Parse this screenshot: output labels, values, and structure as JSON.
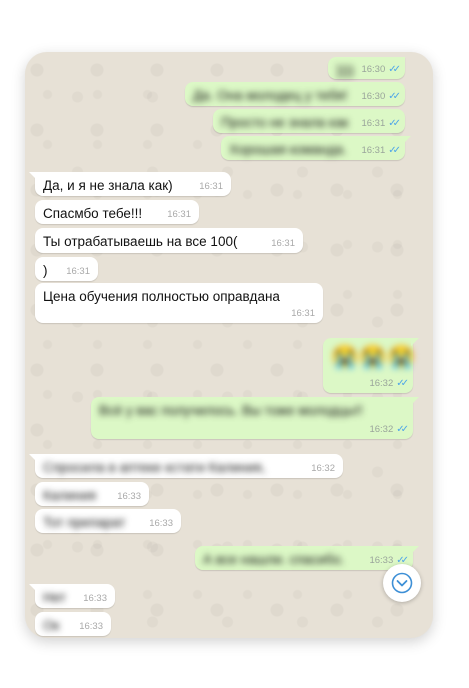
{
  "messages": [
    {
      "side": "out",
      "text": "))))",
      "time": "16:30",
      "blurred": true
    },
    {
      "side": "out",
      "text": "Да. Она молодец у тебя!",
      "time": "16:30",
      "blurred": true
    },
    {
      "side": "out",
      "text": "Просто не знала как",
      "time": "16:31",
      "blurred": true
    },
    {
      "side": "out",
      "text": "Хорошая команда.",
      "time": "16:31",
      "blurred": true
    },
    {
      "side": "in",
      "text": "Да, и я не знала как)",
      "time": "16:31",
      "blurred": false
    },
    {
      "side": "in",
      "text": "Спасмбо тебе!!!",
      "time": "16:31",
      "blurred": false
    },
    {
      "side": "in",
      "text": "Ты отрабатываешь на все 100(",
      "time": "16:31",
      "blurred": false
    },
    {
      "side": "in",
      "text": ")",
      "time": "16:31",
      "blurred": false
    },
    {
      "side": "in",
      "text": "Цена обучения полностью оправдана",
      "time": "16:31",
      "blurred": false
    },
    {
      "side": "out",
      "text": "😭😭😭",
      "time": "16:32",
      "blurred": true
    },
    {
      "side": "out",
      "text": "Всё у вас получилось. Вы тоже молодцы!!",
      "time": "16:32",
      "blurred": true
    },
    {
      "side": "in",
      "text": "Спросила в аптеке кстати Калиния,",
      "time": "16:32",
      "blurred": true
    },
    {
      "side": "in",
      "text": "Калиния",
      "time": "16:33",
      "blurred": true
    },
    {
      "side": "in",
      "text": "Тот препарат",
      "time": "16:33",
      "blurred": true
    },
    {
      "side": "out",
      "text": "А все нашли. спасибо.",
      "time": "16:33",
      "blurred": true
    },
    {
      "side": "in",
      "text": "Нет",
      "time": "16:33",
      "blurred": true
    },
    {
      "side": "in",
      "text": "Ок",
      "time": "16:33",
      "blurred": true
    }
  ],
  "read_check": "✓✓",
  "icons": {
    "scroll_down": "chevron-down-icon"
  },
  "colors": {
    "incoming": "#ffffff",
    "outgoing": "#dcf8c6",
    "background": "#e7e1d6",
    "check": "#4fa6e8"
  }
}
